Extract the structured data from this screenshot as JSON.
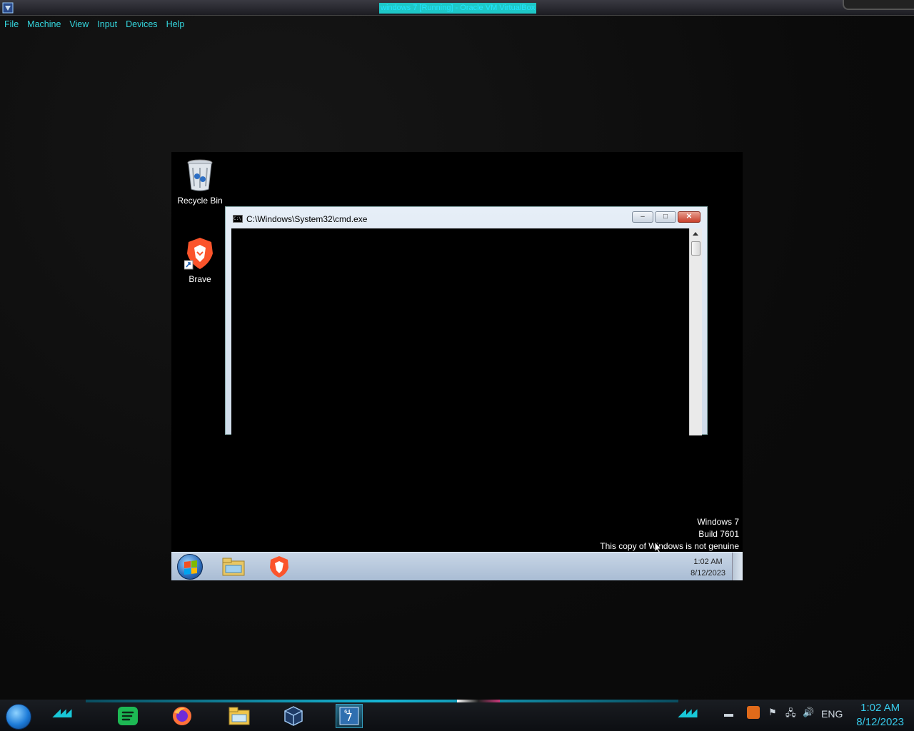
{
  "host": {
    "title": "windows 7 [Running] - Oracle VM VirtualBox",
    "menu": [
      "File",
      "Machine",
      "View",
      "Input",
      "Devices",
      "Help"
    ],
    "colors": {
      "accent": "#35d8e0",
      "title_highlight": "#1ec7c7"
    }
  },
  "vm": {
    "desktop_icons": [
      {
        "label": "Recycle Bin",
        "icon": "recycle-bin-icon"
      },
      {
        "label": "Brave",
        "icon": "brave-shortcut-icon"
      }
    ],
    "cmd_window": {
      "title": "C:\\Windows\\System32\\cmd.exe",
      "icon_text": "C:\\",
      "buttons": {
        "minimize": "–",
        "maximize": "□",
        "close": "✕"
      }
    },
    "watermark": {
      "line1": "Windows 7",
      "line2": "Build 7601",
      "line3": "This copy of Windows is not genuine"
    },
    "taskbar": {
      "pinned": [
        "windows-explorer-icon",
        "brave-icon"
      ],
      "time": "1:02 AM",
      "date": "8/12/2023"
    }
  },
  "host_taskbar": {
    "apps": [
      "spotify-icon",
      "firefox-icon",
      "file-explorer-icon",
      "virtualbox-icon",
      "windows7-vm-icon"
    ],
    "tray": {
      "language": "ENG"
    },
    "time": "1:02 AM",
    "date": "8/12/2023"
  }
}
